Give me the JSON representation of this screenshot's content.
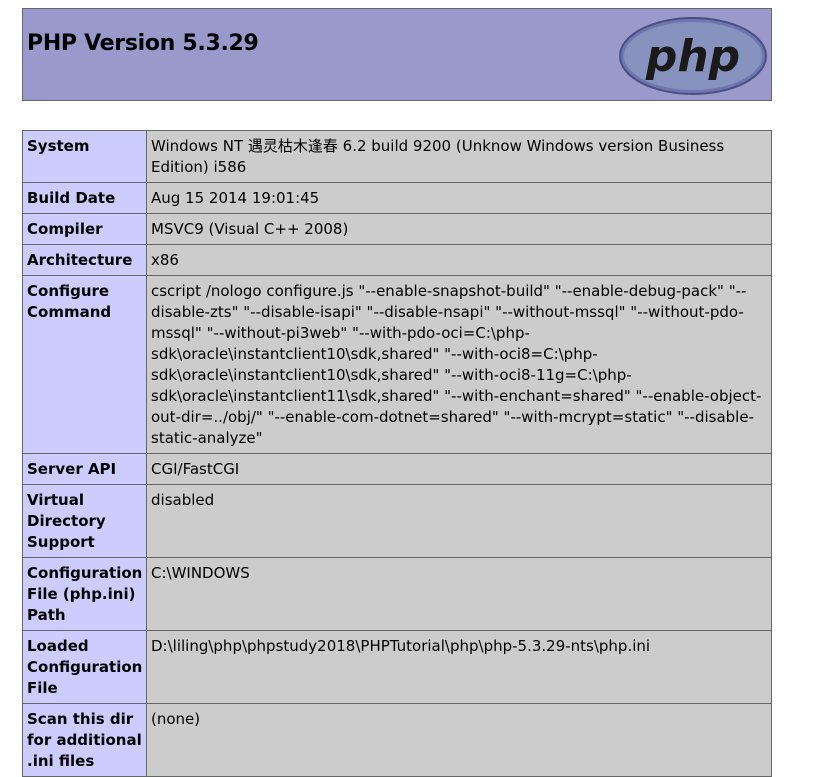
{
  "header": {
    "title": "PHP Version 5.3.29",
    "logo_text": "php"
  },
  "rows": [
    {
      "label": "System",
      "value": "Windows NT 遇灵枯木逢春 6.2 build 9200 (Unknow Windows version Business Edition) i586"
    },
    {
      "label": "Build Date",
      "value": "Aug 15 2014 19:01:45"
    },
    {
      "label": "Compiler",
      "value": "MSVC9 (Visual C++ 2008)"
    },
    {
      "label": "Architecture",
      "value": "x86"
    },
    {
      "label": "Configure Command",
      "value": "cscript /nologo configure.js \"--enable-snapshot-build\" \"--enable-debug-pack\" \"--disable-zts\" \"--disable-isapi\" \"--disable-nsapi\" \"--without-mssql\" \"--without-pdo-mssql\" \"--without-pi3web\" \"--with-pdo-oci=C:\\php-sdk\\oracle\\instantclient10\\sdk,shared\" \"--with-oci8=C:\\php-sdk\\oracle\\instantclient10\\sdk,shared\" \"--with-oci8-11g=C:\\php-sdk\\oracle\\instantclient11\\sdk,shared\" \"--with-enchant=shared\" \"--enable-object-out-dir=../obj/\" \"--enable-com-dotnet=shared\" \"--with-mcrypt=static\" \"--disable-static-analyze\""
    },
    {
      "label": "Server API",
      "value": "CGI/FastCGI"
    },
    {
      "label": "Virtual Directory Support",
      "value": "disabled"
    },
    {
      "label": "Configuration File (php.ini) Path",
      "value": "C:\\WINDOWS"
    },
    {
      "label": "Loaded Configuration File",
      "value": "D:\\liling\\php\\phpstudy2018\\PHPTutorial\\php\\php-5.3.29-nts\\php.ini"
    },
    {
      "label": "Scan this dir for additional .ini files",
      "value": "(none)"
    }
  ]
}
